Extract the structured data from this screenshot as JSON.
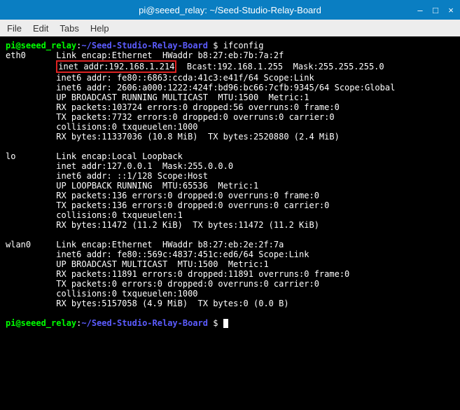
{
  "window": {
    "title": "pi@seeed_relay: ~/Seed-Studio-Relay-Board"
  },
  "menu": {
    "file": "File",
    "edit": "Edit",
    "tabs": "Tabs",
    "help": "Help"
  },
  "prompt": {
    "user_host": "pi@seeed_relay",
    "colon": ":",
    "path": "~/Seed-Studio-Relay-Board",
    "dollar": " $ "
  },
  "cmd1": "ifconfig",
  "eth0": {
    "l1a": "eth0      Link encap:Ethernet  HWaddr b8:27:eb:7b:7a:2f",
    "l2_highlight": "inet addr:192.168.1.214",
    "l2_rest": "  Bcast:192.168.1.255  Mask:255.255.255.0",
    "l3": "          inet6 addr: fe80::6863:ccda:41c3:e41f/64 Scope:Link",
    "l4": "          inet6 addr: 2606:a000:1222:424f:bd96:bc66:7cfb:9345/64 Scope:Global",
    "l5": "          UP BROADCAST RUNNING MULTICAST  MTU:1500  Metric:1",
    "l6": "          RX packets:103724 errors:0 dropped:56 overruns:0 frame:0",
    "l7": "          TX packets:7732 errors:0 dropped:0 overruns:0 carrier:0",
    "l8": "          collisions:0 txqueuelen:1000",
    "l9": "          RX bytes:11337036 (10.8 MiB)  TX bytes:2520880 (2.4 MiB)"
  },
  "lo": {
    "l1": "lo        Link encap:Local Loopback",
    "l2": "          inet addr:127.0.0.1  Mask:255.0.0.0",
    "l3": "          inet6 addr: ::1/128 Scope:Host",
    "l4": "          UP LOOPBACK RUNNING  MTU:65536  Metric:1",
    "l5": "          RX packets:136 errors:0 dropped:0 overruns:0 frame:0",
    "l6": "          TX packets:136 errors:0 dropped:0 overruns:0 carrier:0",
    "l7": "          collisions:0 txqueuelen:1",
    "l8": "          RX bytes:11472 (11.2 KiB)  TX bytes:11472 (11.2 KiB)"
  },
  "wlan0": {
    "l1": "wlan0     Link encap:Ethernet  HWaddr b8:27:eb:2e:2f:7a",
    "l2": "          inet6 addr: fe80::569c:4837:451c:ed6/64 Scope:Link",
    "l3": "          UP BROADCAST MULTICAST  MTU:1500  Metric:1",
    "l4": "          RX packets:11891 errors:0 dropped:11891 overruns:0 frame:0",
    "l5": "          TX packets:0 errors:0 dropped:0 overruns:0 carrier:0",
    "l6": "          collisions:0 txqueuelen:1000",
    "l7": "          RX bytes:5157058 (4.9 MiB)  TX bytes:0 (0.0 B)"
  },
  "indent10": "          "
}
